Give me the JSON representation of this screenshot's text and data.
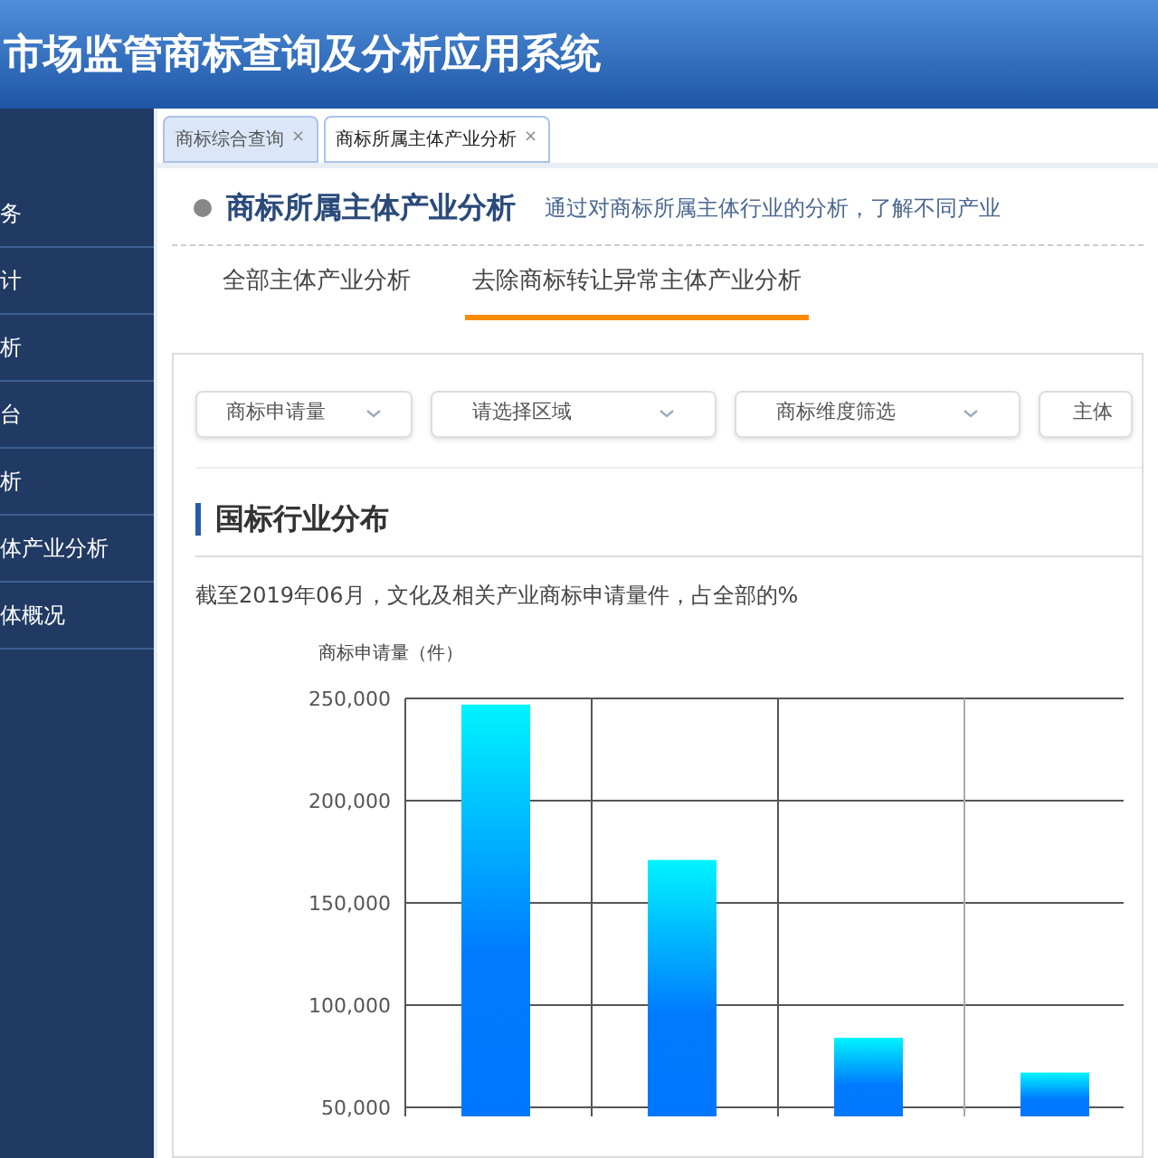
{
  "header": {
    "title": "市场监管商标查询及分析应用系统"
  },
  "sidebar": {
    "items": [
      {
        "label": "务"
      },
      {
        "label": "计"
      },
      {
        "label": "析"
      },
      {
        "label": "台"
      },
      {
        "label": "析"
      },
      {
        "label": "体产业分析"
      },
      {
        "label": "体概况"
      }
    ]
  },
  "page_tabs": [
    {
      "label": "商标综合查询",
      "close": "×",
      "selected": false
    },
    {
      "label": "商标所属主体产业分析",
      "close": "×",
      "selected": true
    }
  ],
  "page": {
    "title": "商标所属主体产业分析",
    "description": "通过对商标所属主体行业的分析，了解不同产业",
    "tabs": [
      {
        "label": "全部主体产业分析",
        "selected": false
      },
      {
        "label": "去除商标转让异常主体产业分析",
        "selected": true
      }
    ],
    "filters": [
      "商标申请量",
      "请选择区域",
      "商标维度筛选",
      "主体"
    ],
    "section_title": "国标行业分布",
    "summary": "截至2019年06月，文化及相关产业商标申请量件，占全部的%",
    "chart_data": {
      "type": "bar",
      "grid": true,
      "ylabel": "商标申请量（件）",
      "values": [
        247000,
        171000,
        84000,
        67000
      ],
      "ylim": [
        50000,
        250000
      ],
      "yticks": [
        {
          "value": 50000,
          "label": "50,000"
        },
        {
          "value": 100000,
          "label": "100,000"
        },
        {
          "value": 150000,
          "label": "150,000"
        },
        {
          "value": 200000,
          "label": "200,000"
        },
        {
          "value": 250000,
          "label": "250,000"
        }
      ]
    }
  }
}
